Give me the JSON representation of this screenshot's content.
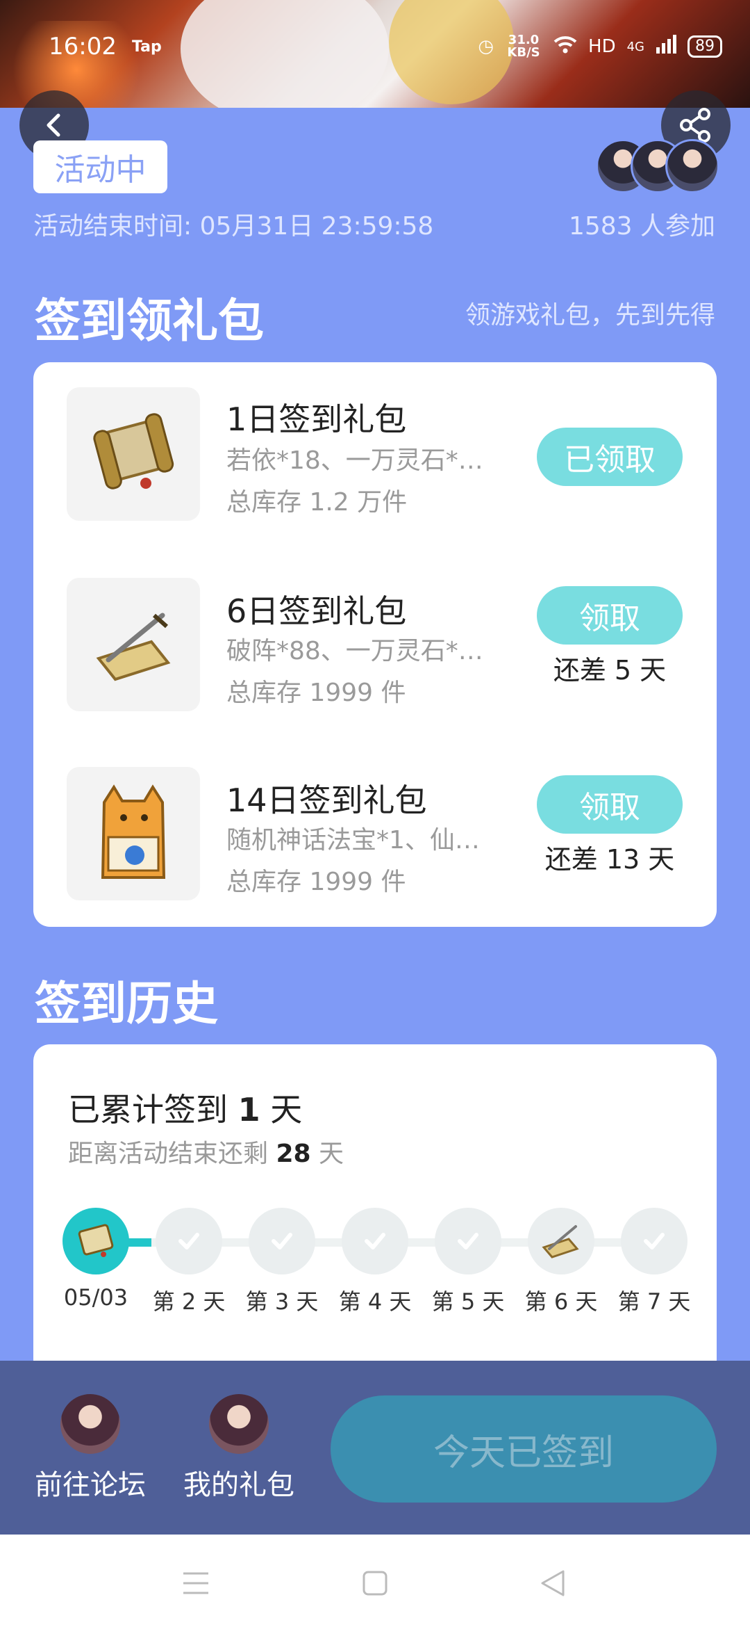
{
  "status_bar": {
    "time": "16:02",
    "app_badge": "Tap",
    "net_speed": "31.0 KB/S",
    "hd": "HD",
    "network": "4G",
    "battery": "89"
  },
  "activity": {
    "status": "活动中",
    "end_time": "活动结束时间: 05月31日 23:59:58",
    "participants": "1583 人参加"
  },
  "signin_section": {
    "title": "签到领礼包",
    "subtitle": "领游戏礼包，先到先得"
  },
  "gifts": [
    {
      "name": "1日签到礼包",
      "desc": "若依*18、一万灵石*…",
      "stock": "总库存 1.2 万件",
      "button": "已领取",
      "remain": "",
      "icon": "scroll-icon"
    },
    {
      "name": "6日签到礼包",
      "desc": "破阵*88、一万灵石*…",
      "stock": "总库存 1999 件",
      "button": "领取",
      "remain": "还差 5 天",
      "icon": "sword-scroll-icon"
    },
    {
      "name": "14日签到礼包",
      "desc": "随机神话法宝*1、仙…",
      "stock": "总库存 1999 件",
      "button": "领取",
      "remain": "还差 13 天",
      "icon": "cat-bag-icon"
    }
  ],
  "history_section": {
    "title": "签到历史"
  },
  "history": {
    "accum_prefix": "已累计签到",
    "accum_days": "1",
    "accum_suffix": "天",
    "remain_prefix": "距离活动结束还剩",
    "remain_days": "28",
    "remain_suffix": "天",
    "days": [
      "05/03",
      "第 2 天",
      "第 3 天",
      "第 4 天",
      "第 5 天",
      "第 6 天",
      "第 7 天"
    ]
  },
  "bottom_bar": {
    "forum": "前往论坛",
    "my_gifts": "我的礼包",
    "signed": "今天已签到"
  },
  "colors": {
    "background": "#7f9af6",
    "accent": "#22c6c9",
    "button": "#79dde0",
    "bottom_bar": "#4f5f98"
  }
}
